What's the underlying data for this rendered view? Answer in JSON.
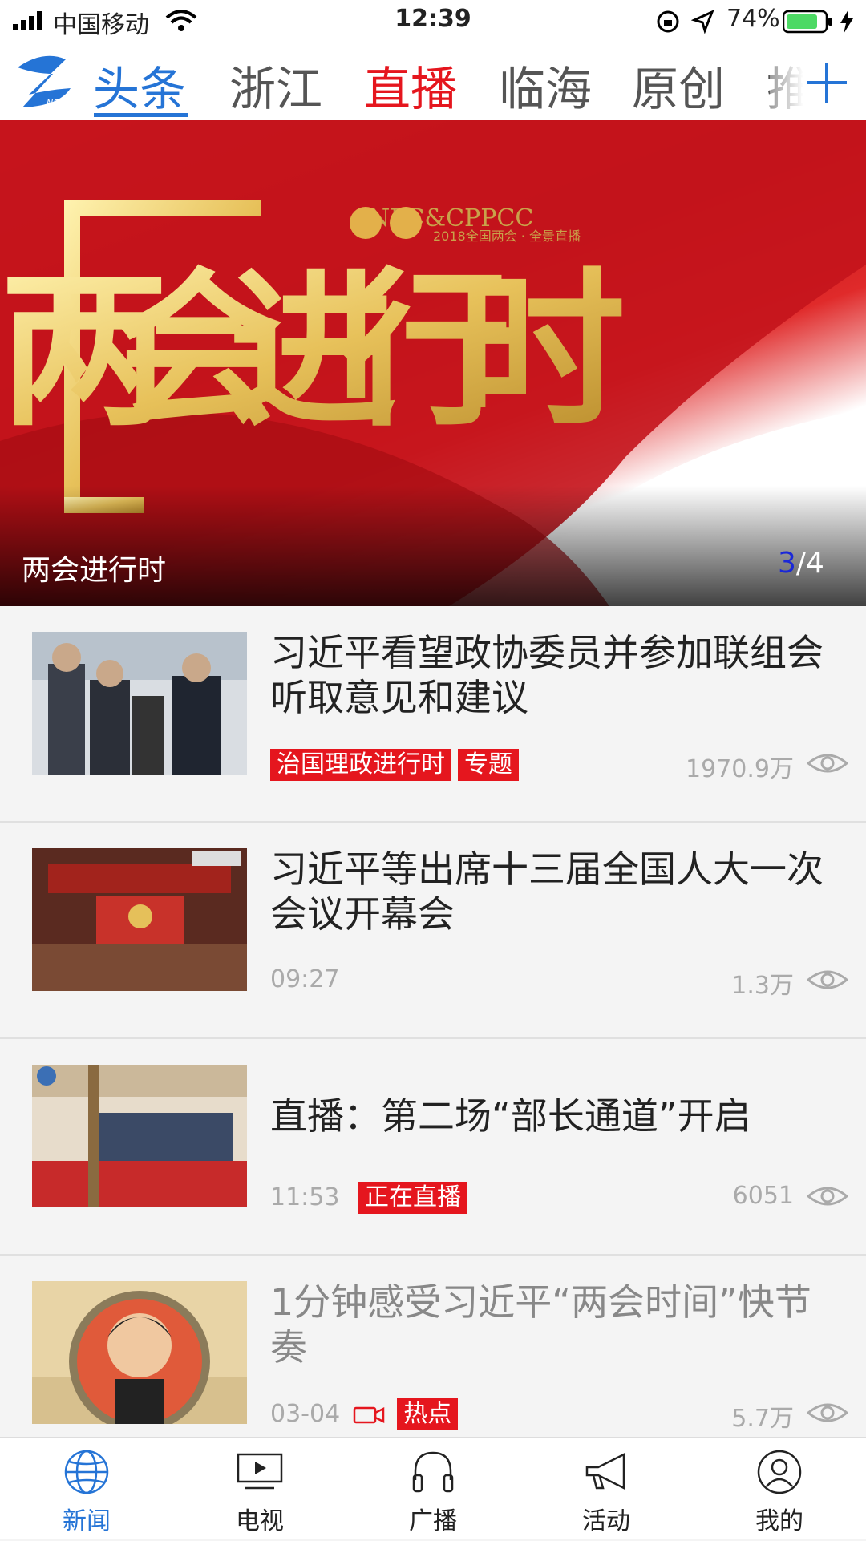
{
  "status": {
    "carrier": "中国移动",
    "time": "12:39",
    "battery": "74%"
  },
  "channels": [
    {
      "label": "头条"
    },
    {
      "label": "浙江"
    },
    {
      "label": "直播"
    },
    {
      "label": "临海"
    },
    {
      "label": "原创"
    },
    {
      "label": "推"
    }
  ],
  "banner": {
    "art_text": "两会进行时",
    "npc_text": "NPC&CPPCC",
    "npc_sub": "2018全国两会 · 全景直播",
    "caption": "两会进行时",
    "pager_current": "3",
    "pager_total": "/4"
  },
  "news": [
    {
      "title": "习近平看望政协委员并参加联组会听取意见和建议",
      "tags": [
        "治国理政进行时",
        "专题"
      ],
      "time": "",
      "views": "1970.9万"
    },
    {
      "title": "习近平等出席十三届全国人大一次会议开幕会",
      "tags": [],
      "time": "09:27",
      "views": "1.3万"
    },
    {
      "title": "直播：第二场“部长通道”开启",
      "tags": [
        "正在直播"
      ],
      "time": "11:53",
      "views": "6051"
    },
    {
      "title": "1分钟感受习近平“两会时间”快节奏",
      "tags": [
        "热点"
      ],
      "time": "03-04",
      "views": "5.7万"
    }
  ],
  "tabbar": [
    {
      "label": "新闻",
      "icon": "globe-icon"
    },
    {
      "label": "电视",
      "icon": "tv-icon"
    },
    {
      "label": "广播",
      "icon": "headphones-icon"
    },
    {
      "label": "活动",
      "icon": "megaphone-icon"
    },
    {
      "label": "我的",
      "icon": "user-icon"
    }
  ],
  "colors": {
    "accent": "#2574d6",
    "live": "#e5161e",
    "tag": "#e5161e"
  }
}
